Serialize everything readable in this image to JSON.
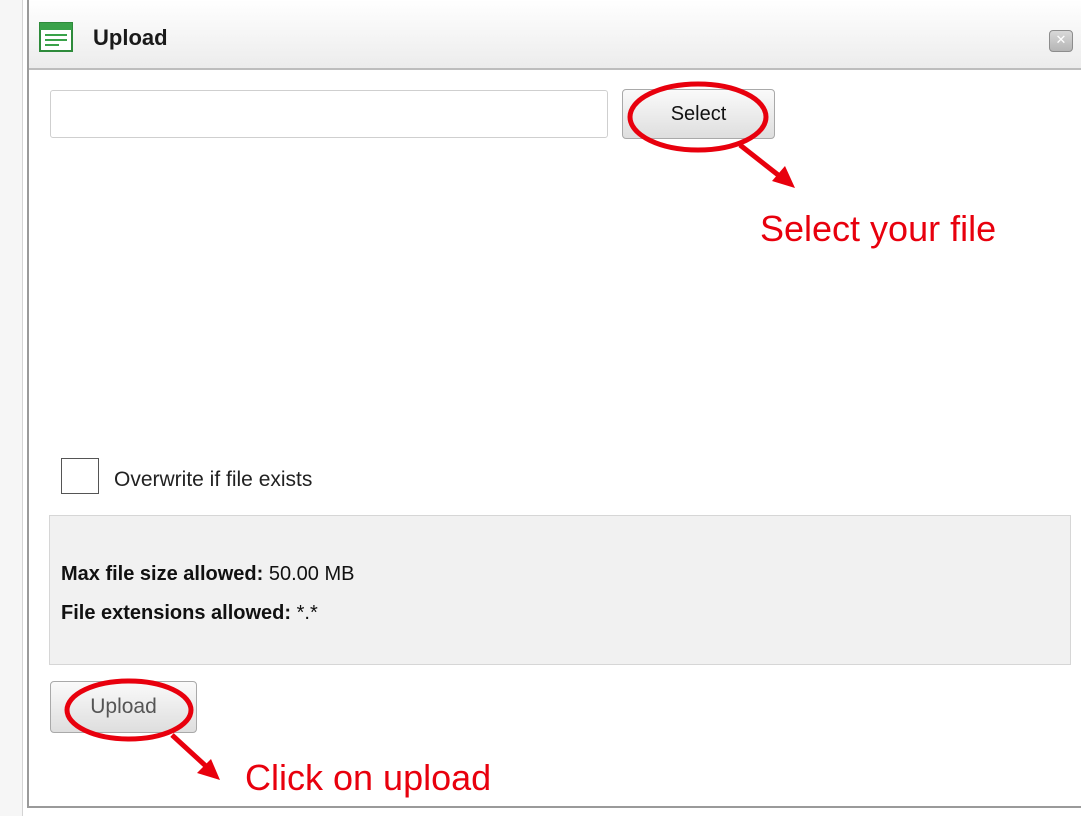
{
  "dialog": {
    "title": "Upload",
    "close_glyph": "✕"
  },
  "file_input": {
    "value": "",
    "placeholder": ""
  },
  "select_button": {
    "label": "Select"
  },
  "overwrite": {
    "label": "Overwrite if file exists",
    "checked": false
  },
  "info": {
    "max_size_label": "Max file size allowed:",
    "max_size_value": "50.00 MB",
    "extensions_label": "File extensions allowed:",
    "extensions_value": "*.*"
  },
  "upload_button": {
    "label": "Upload"
  },
  "annotations": {
    "select_hint": "Select your file",
    "upload_hint": "Click on upload",
    "color": "#e8000d"
  }
}
